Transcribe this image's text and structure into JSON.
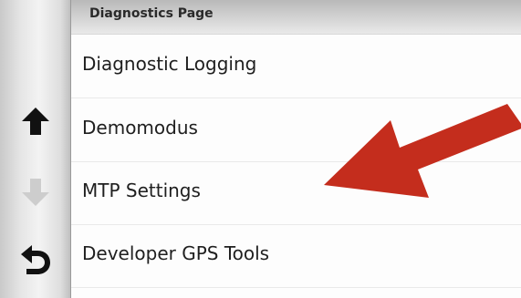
{
  "header": {
    "title": "Diagnostics Page"
  },
  "sidebar": {
    "buttons": [
      {
        "name": "scroll-up",
        "icon": "arrow-up-icon",
        "color": "#111111",
        "enabled": true
      },
      {
        "name": "scroll-down",
        "icon": "arrow-down-icon",
        "color": "#cfcfcf",
        "enabled": false
      },
      {
        "name": "back",
        "icon": "back-arrow-icon",
        "color": "#111111",
        "enabled": true
      }
    ]
  },
  "list": {
    "items": [
      {
        "label": "Diagnostic Logging"
      },
      {
        "label": "Demomodus"
      },
      {
        "label": "MTP Settings"
      },
      {
        "label": "Developer GPS Tools"
      }
    ]
  },
  "annotation": {
    "type": "arrow",
    "color": "#c42d1d",
    "points_to": "MTP Settings"
  }
}
